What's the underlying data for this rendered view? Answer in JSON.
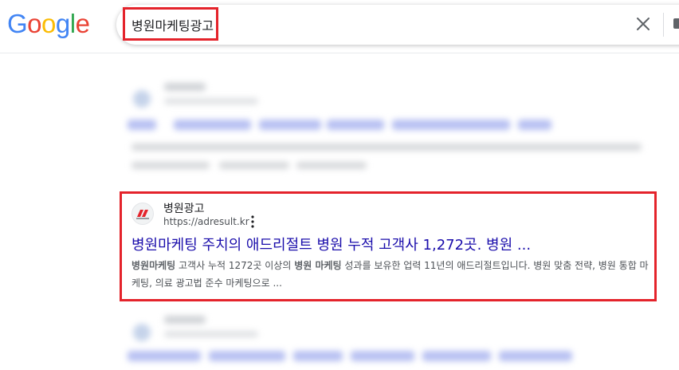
{
  "logo": {
    "letters": [
      "G",
      "o",
      "o",
      "g",
      "l",
      "e"
    ],
    "colors": [
      "#4285F4",
      "#EA4335",
      "#FBBC05",
      "#4285F4",
      "#34A853",
      "#EA4335"
    ]
  },
  "search": {
    "query": "병원마케팅광고"
  },
  "icons": {
    "clear": "close-icon",
    "more": "more-vert-icon"
  },
  "result": {
    "site_name": "병원광고",
    "url": "https://adresult.kr",
    "title": "병원마케팅 주치의 애드리절트 병원 누적 고객사 1,272곳. 병원 ...",
    "snippet": {
      "bold1": "병원마케팅",
      "text1": " 고객사 누적 1272곳 이상의 ",
      "bold2": "병원 마케팅",
      "text2": " 성과를 보유한 업력 11년의 애드리절트입니다. 병원 맞춤 전략, 병원 통합 마케팅, 의료 광고법 준수 마케팅으로 ..."
    }
  },
  "colors": {
    "highlight": "#e4232b",
    "link": "#1a0dab"
  }
}
